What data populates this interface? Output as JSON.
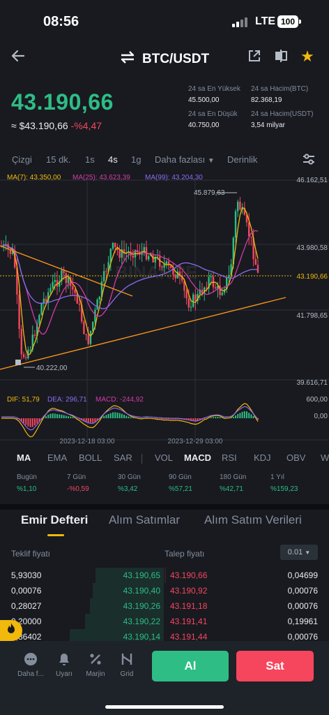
{
  "status": {
    "time": "08:56",
    "network": "LTE",
    "battery": "100"
  },
  "header": {
    "pair": "BTC/USDT",
    "icons": [
      "back-arrow",
      "swap-icon",
      "share-icon",
      "compare-icon",
      "star-icon"
    ]
  },
  "price": {
    "last": "43.190,66",
    "converted": "≈ $43.190,66",
    "change": "-%4,47",
    "high_label": "24 sa En Yüksek",
    "high": "45.500,00",
    "vol_btc_label": "24 sa Hacim(BTC)",
    "vol_btc": "82.368,19",
    "low_label": "24 sa En Düşük",
    "low": "40.750,00",
    "vol_usdt_label": "24 sa Hacim(USDT)",
    "vol_usdt": "3,54 milyar"
  },
  "timeframes": {
    "line": "Çizgi",
    "m15": "15 dk.",
    "h1": "1s",
    "h4": "4s",
    "d1": "1g",
    "more": "Daha fazlası",
    "depth": "Derinlik"
  },
  "chart": {
    "ma7": "MA(7): 43.350,00",
    "ma25": "MA(25): 43.623,39",
    "ma99": "MA(99): 43.204,30",
    "axis": [
      "46.162,51",
      "43.980,58",
      "41.798,65",
      "39.616,71"
    ],
    "current_tag": "43.190,66",
    "high_mark": "45.879,63",
    "low_mark": "40.222,00",
    "dif": "DIF: 51,79",
    "dea": "DEA: 296,71",
    "macd": "MACD: -244,92",
    "macd_axis": [
      "600,00",
      "0,00"
    ],
    "dates": [
      "2023-12-18 03:00",
      "2023-12-29 03:00"
    ],
    "watermark": "BINANCE",
    "colors": {
      "up": "#2ebd85",
      "down": "#f6465d",
      "ma7": "#f0b90b",
      "ma25": "#d63aa5",
      "ma99": "#8b6cf0",
      "trend": "#f7931a"
    }
  },
  "chart_data": {
    "type": "candlestick",
    "ylim": [
      39616.71,
      46162.51
    ],
    "y_ticks": [
      46162.51,
      43980.58,
      41798.65,
      39616.71
    ],
    "x_ticks": [
      "2023-12-18 03:00",
      "2023-12-29 03:00"
    ],
    "last_price": 43190.66,
    "period_high": 45879.63,
    "period_low": 40222.0,
    "ma": {
      "MA7": 43350.0,
      "MA25": 43623.39,
      "MA99": 43204.3
    },
    "macd": {
      "DIF": 51.79,
      "DEA": 296.71,
      "MACD": -244.92,
      "ylim_label": [
        0,
        600
      ]
    }
  },
  "indicators": {
    "ma": "MA",
    "ema": "EMA",
    "boll": "BOLL",
    "sar": "SAR",
    "vol": "VOL",
    "macd": "MACD",
    "rsi": "RSI",
    "kdj": "KDJ",
    "obv": "OBV",
    "w": "W"
  },
  "performance": [
    {
      "label": "Bugün",
      "value": "%1,10",
      "neg": false
    },
    {
      "label": "7 Gün",
      "value": "-%0,59",
      "neg": true
    },
    {
      "label": "30 Gün",
      "value": "%3,42",
      "neg": false
    },
    {
      "label": "90 Gün",
      "value": "%57,21",
      "neg": false
    },
    {
      "label": "180 Gün",
      "value": "%42,71",
      "neg": false
    },
    {
      "label": "1 Yıl",
      "value": "%159,23",
      "neg": false
    }
  ],
  "orderbook": {
    "tabs": [
      "Emir Defteri",
      "Alım Satımlar",
      "Alım Satım Verileri"
    ],
    "bid_header": "Teklif fiyatı",
    "ask_header": "Talep fiyatı",
    "precision": "0.01",
    "rows": [
      {
        "bid_qty": "5,93030",
        "bid": "43.190,65",
        "ask": "43.190,66",
        "ask_qty": "0,04699"
      },
      {
        "bid_qty": "0,00076",
        "bid": "43.190,40",
        "ask": "43.190,92",
        "ask_qty": "0,00076"
      },
      {
        "bid_qty": "0,28027",
        "bid": "43.190,26",
        "ask": "43.191,18",
        "ask_qty": "0,00076"
      },
      {
        "bid_qty": "0,20000",
        "bid": "43.190,22",
        "ask": "43.191,41",
        "ask_qty": "0,19961"
      },
      {
        "bid_qty": "0,86402",
        "bid": "43.190,14",
        "ask": "43.191,44",
        "ask_qty": "0,00076"
      }
    ]
  },
  "bottom": {
    "more": "Daha f...",
    "alerts": "Uyarı",
    "margin": "Marjin",
    "grid": "Grid",
    "buy": "Al",
    "sell": "Sat"
  }
}
